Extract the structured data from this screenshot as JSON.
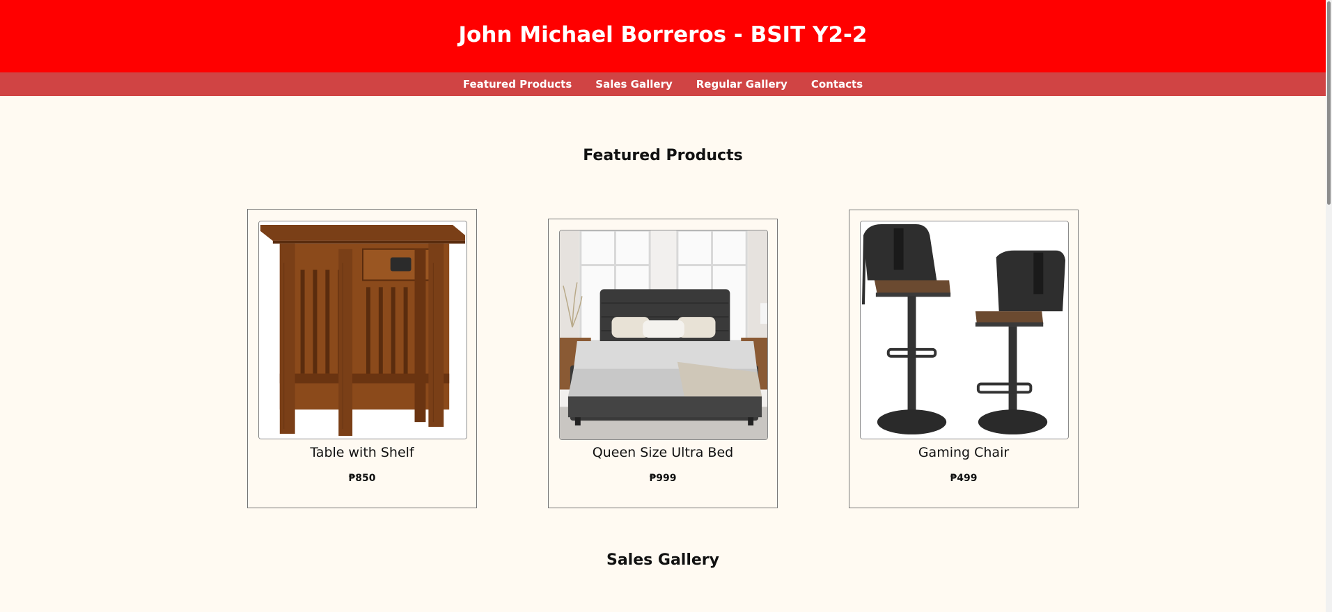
{
  "header": {
    "title": "John Michael Borreros - BSIT Y2-2"
  },
  "nav": {
    "items": [
      {
        "label": "Featured Products"
      },
      {
        "label": "Sales Gallery"
      },
      {
        "label": "Regular Gallery"
      },
      {
        "label": "Contacts"
      }
    ]
  },
  "featured": {
    "title": "Featured Products",
    "products": [
      {
        "name": "Table with Shelf",
        "price": "₱850",
        "image": "wooden-side-table-image"
      },
      {
        "name": "Queen Size Ultra Bed",
        "price": "₱999",
        "image": "upholstered-bed-image"
      },
      {
        "name": "Gaming Chair",
        "price": "₱499",
        "image": "bar-stool-chairs-image"
      }
    ]
  },
  "sales": {
    "title": "Sales Gallery"
  },
  "colors": {
    "header_bg": "#ff0000",
    "nav_bg": "#d04444",
    "page_bg": "#fffaf2"
  }
}
